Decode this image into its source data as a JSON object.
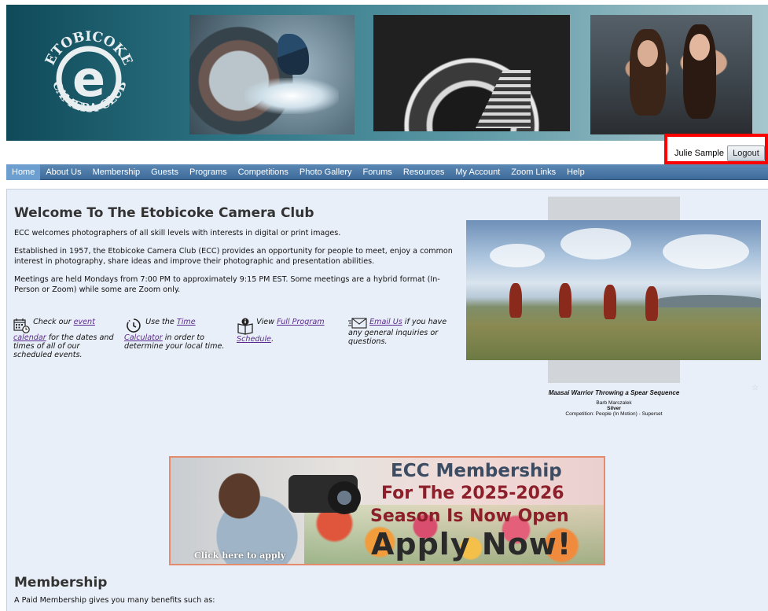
{
  "header": {
    "logo": {
      "top_text": "ETOBICOKE",
      "letter": "e",
      "bottom_text": "CAMERA CLUB"
    }
  },
  "user": {
    "name": "Julie Sample",
    "logout_label": "Logout"
  },
  "nav": {
    "items": [
      "Home",
      "About Us",
      "Membership",
      "Guests",
      "Programs",
      "Competitions",
      "Photo Gallery",
      "Forums",
      "Resources",
      "My Account",
      "Zoom Links",
      "Help"
    ],
    "active": "Home"
  },
  "welcome": {
    "title": "Welcome To The Etobicoke Camera Club",
    "p1": "ECC welcomes photographers of all skill levels with interests in digital or print images.",
    "p2": "Established in 1957, the Etobicoke Camera Club (ECC) provides an opportunity for people to meet, enjoy a common interest in photography, share ideas and improve their photographic and presentation abilities.",
    "p3": "Meetings are held Mondays from 7:00 PM to approximately 9:15 PM EST. Some meetings are a hybrid format (In-Person or Zoom) while some are Zoom only."
  },
  "quick_links": [
    {
      "icon": "calendar-icon",
      "before": "Check our ",
      "link": "event calendar",
      "after": " for the dates and times of all of our scheduled events."
    },
    {
      "icon": "clock-icon",
      "before": "Use the ",
      "link": "Time Calculator",
      "after": " in order to determine your local time."
    },
    {
      "icon": "book-info-icon",
      "before": "View ",
      "link": "Full Program Schedule",
      "after": "."
    },
    {
      "icon": "envelope-icon",
      "before": "",
      "link": "Email Us",
      "after": " if you have any general inquiries or questions."
    }
  ],
  "featured": {
    "title": "Maasai Warrior Throwing a Spear Sequence",
    "author": "Barb Marszalek",
    "award": "Silver",
    "competition": "Competition: People (In Motion) - Superset"
  },
  "membership_banner": {
    "line1": "ECC Membership",
    "line2": "For The 2025-2026",
    "line3": "Season Is Now Open",
    "line4": "Apply Now!",
    "click_text": "Click here to apply"
  },
  "membership": {
    "title": "Membership",
    "text": "A Paid Membership gives you many benefits such as:"
  }
}
